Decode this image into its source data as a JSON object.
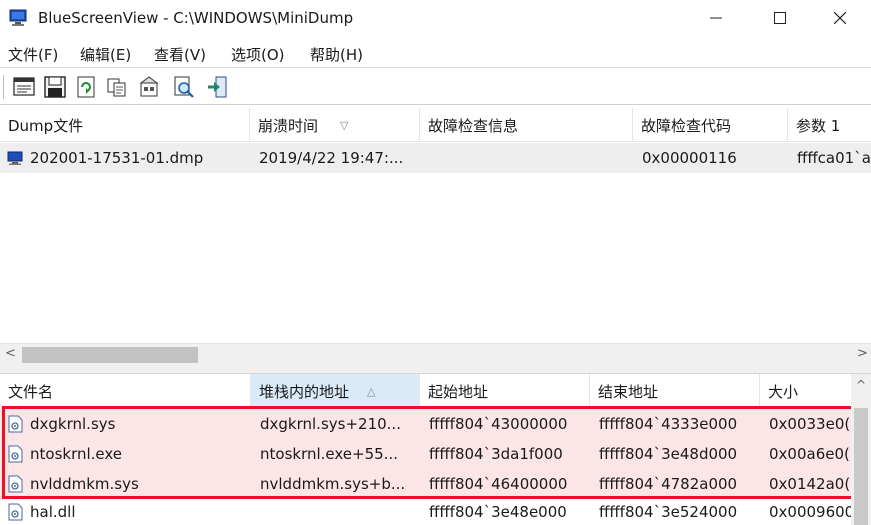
{
  "window": {
    "title": "BlueScreenView  -  C:\\WINDOWS\\MiniDump"
  },
  "window_controls": {
    "minimize": "—",
    "maximize": "☐",
    "close": "✕"
  },
  "menu": [
    "文件(F)",
    "编辑(E)",
    "查看(V)",
    "选项(O)",
    "帮助(H)"
  ],
  "toolbar": {
    "icons": [
      "properties-icon",
      "save-icon",
      "refresh-icon",
      "copy-icon",
      "html-report-icon",
      "find-icon",
      "exit-icon"
    ]
  },
  "dump_list": {
    "columns": [
      "Dump文件",
      "崩溃时间",
      "故障检查信息",
      "故障检查代码",
      "参数 1"
    ],
    "sort_indicator": "▽",
    "rows": [
      {
        "dump_file": "202001-17531-01.dmp",
        "crash_time": "2019/4/22 19:47:...",
        "bug_check_string": "",
        "bug_check_code": "0x00000116",
        "param1": "ffffca01`a"
      }
    ]
  },
  "scroll": {
    "left_arrow": "<",
    "right_arrow": ">",
    "up_arrow": "^"
  },
  "driver_list": {
    "columns": [
      "文件名",
      "堆栈内的地址",
      "起始地址",
      "结束地址",
      "大小"
    ],
    "sort_indicator": "△",
    "rows": [
      {
        "filename": "dxgkrnl.sys",
        "stack_address": "dxgkrnl.sys+210...",
        "start": "fffff804`43000000",
        "end": "fffff804`4333e000",
        "size": "0x0033e0(",
        "highlighted": true
      },
      {
        "filename": "ntoskrnl.exe",
        "stack_address": "ntoskrnl.exe+55...",
        "start": "fffff804`3da1f000",
        "end": "fffff804`3e48d000",
        "size": "0x00a6e0(",
        "highlighted": true
      },
      {
        "filename": "nvlddmkm.sys",
        "stack_address": "nvlddmkm.sys+b...",
        "start": "fffff804`46400000",
        "end": "fffff804`4782a000",
        "size": "0x0142a0(",
        "highlighted": true
      },
      {
        "filename": "hal.dll",
        "stack_address": "",
        "start": "fffff804`3e48e000",
        "end": "fffff804`3e524000",
        "size": "0x0009600",
        "highlighted": false
      }
    ]
  },
  "colors": {
    "highlight_row": "#fbe5e7",
    "highlight_border": "#e4132a",
    "selected_row": "#eeeeee",
    "sorted_header": "#d9ebf9"
  }
}
